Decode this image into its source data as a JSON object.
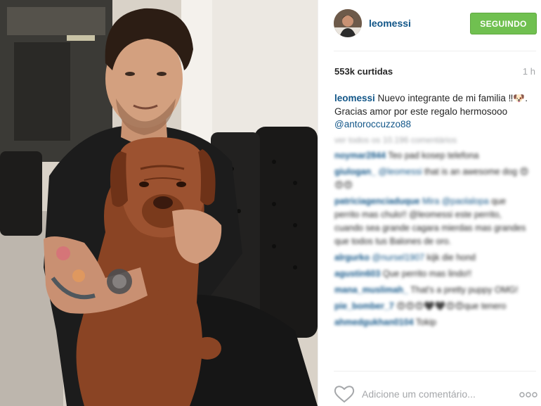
{
  "post": {
    "username": "leomessi",
    "follow_label": "SEGUINDO",
    "likes": "553k curtidas",
    "time": "1 h",
    "caption": {
      "user": "leomessi",
      "text": " Nuevo integrante de mi familia ‼🐶. Gracias amor por este regalo hermosooo ",
      "mention": "@antoroccuzzo88"
    },
    "view_all": "ver todos os 10.196 comentários",
    "comments": [
      {
        "user": "noymar2844",
        "text": "Teo pad kosep telefona"
      },
      {
        "user": "giulogan_",
        "mention": "@leomessi",
        "text": " that is an awesome dog 😍😍😍"
      },
      {
        "user": "patriciagenciaduque",
        "mention": "Mira @paolalopa",
        "text": " que perrito mas chulo!! @leomessi este perrito, cuando sea grande cagara mierdas mas grandes que todos tus Balones de oro."
      },
      {
        "user": "alrgurko",
        "mention": "@nursel1907",
        "text": " kijk die hond"
      },
      {
        "user": "agustin603",
        "text": " Que perrito mas lindo!!"
      },
      {
        "user": "mana_muslimah_",
        "text": " That's a pretty puppy OMG!"
      },
      {
        "user": "pie_bomber_7",
        "text": " 😍😍😍🖤🖤😍😍que tenero"
      },
      {
        "user": "ahmedgukhan0104",
        "text": " Tokip"
      }
    ],
    "add_comment_placeholder": "Adicione um comentário..."
  },
  "icons": {
    "heart": "heart-outline-icon",
    "more": "three-dots-icon"
  },
  "colors": {
    "link": "#125688",
    "follow": "#70c050",
    "muted": "#a5a7aa"
  }
}
